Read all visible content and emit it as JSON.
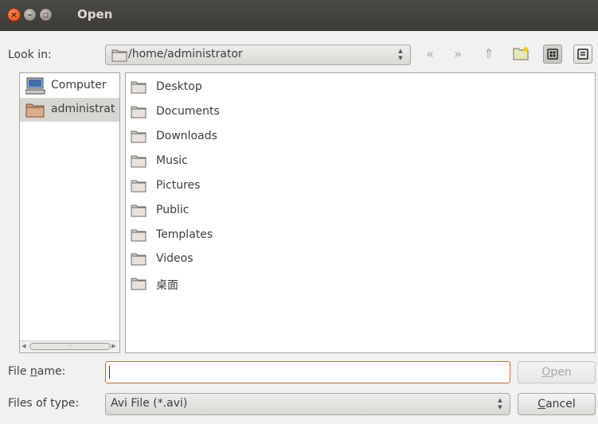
{
  "window": {
    "title": "Open",
    "controls": {
      "close_icon": "close-icon",
      "minimize_icon": "minimize-icon",
      "maximize_icon": "maximize-icon"
    }
  },
  "toolbar": {
    "look_in_label": "Look in:",
    "look_in_path": "/home/administrator",
    "nav_icons": [
      "back-arrow-icon",
      "forward-arrow-icon",
      "parent-directory-icon",
      "new-folder-icon",
      "icon-view-icon",
      "detail-view-icon"
    ]
  },
  "sidebar": {
    "items": [
      {
        "label": "Computer",
        "icon": "computer-icon",
        "selected": false
      },
      {
        "label": "administrat",
        "icon": "home-folder-icon",
        "selected": true
      }
    ]
  },
  "files": {
    "items": [
      {
        "label": "Desktop"
      },
      {
        "label": "Documents"
      },
      {
        "label": "Downloads"
      },
      {
        "label": "Music"
      },
      {
        "label": "Pictures"
      },
      {
        "label": "Public"
      },
      {
        "label": "Templates"
      },
      {
        "label": "Videos"
      },
      {
        "label": "桌面"
      }
    ]
  },
  "footer": {
    "filename_label_pre": "File ",
    "filename_label_u": "n",
    "filename_label_post": "ame:",
    "filename_value": "",
    "open_u": "O",
    "open_rest": "pen",
    "filetype_label": "Files of type:",
    "filetype_value": "Avi File (*.avi)",
    "cancel_u": "C",
    "cancel_rest": "ancel"
  },
  "colors": {
    "accent": "#e0622a",
    "selection": "#d7d6d3",
    "titlebar": "#3c3b37"
  }
}
